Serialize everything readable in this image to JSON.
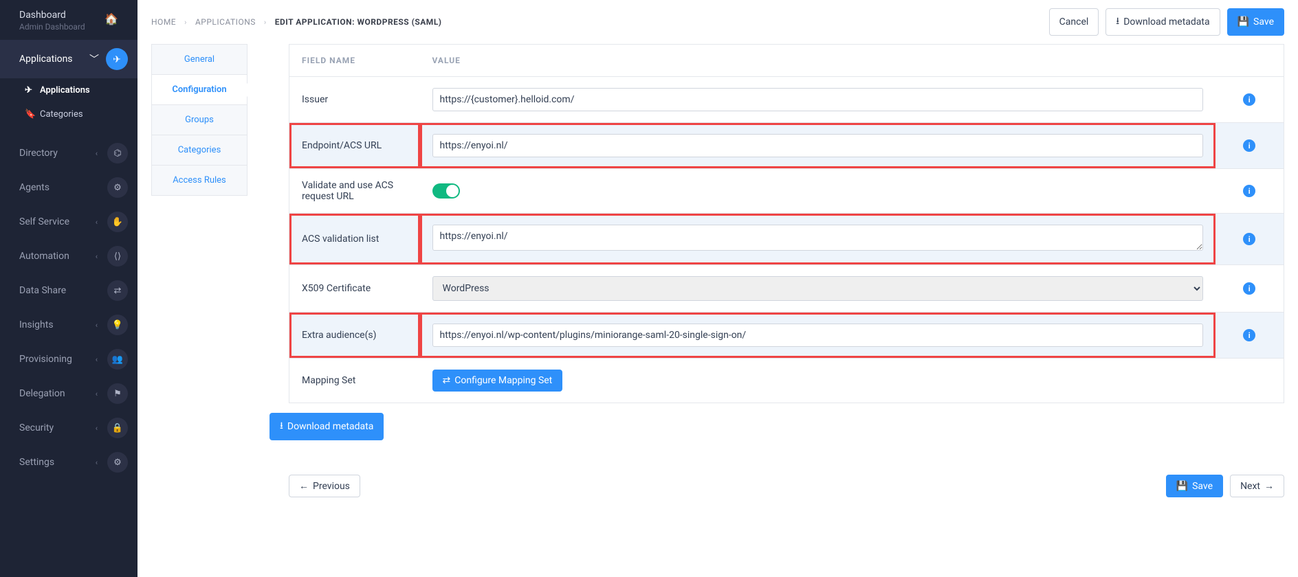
{
  "sidebar": {
    "dashboard": {
      "title": "Dashboard",
      "subtitle": "Admin Dashboard"
    },
    "activeSection": "Applications",
    "sub": {
      "applications": "Applications",
      "categories": "Categories"
    },
    "items": [
      {
        "label": "Directory"
      },
      {
        "label": "Agents"
      },
      {
        "label": "Self Service"
      },
      {
        "label": "Automation"
      },
      {
        "label": "Data Share"
      },
      {
        "label": "Insights"
      },
      {
        "label": "Provisioning"
      },
      {
        "label": "Delegation"
      },
      {
        "label": "Security"
      },
      {
        "label": "Settings"
      }
    ]
  },
  "breadcrumb": {
    "home": "Home",
    "apps": "Applications",
    "current": "Edit Application: WordPress (SAML)"
  },
  "topActions": {
    "cancel": "Cancel",
    "download": "Download metadata",
    "save": "Save"
  },
  "tabs": {
    "general": "General",
    "configuration": "Configuration",
    "groups": "Groups",
    "categories": "Categories",
    "accessRules": "Access Rules"
  },
  "tableHeaders": {
    "field": "Field Name",
    "value": "Value"
  },
  "fields": {
    "issuer": {
      "label": "Issuer",
      "value": "https://{customer}.helloid.com/"
    },
    "endpoint": {
      "label": "Endpoint/ACS URL",
      "value": "https://enyoi.nl/"
    },
    "validateAcs": {
      "label": "Validate and use ACS request URL"
    },
    "acsList": {
      "label": "ACS validation list",
      "value": "https://enyoi.nl/"
    },
    "x509": {
      "label": "X509 Certificate",
      "value": "WordPress"
    },
    "extraAud": {
      "label": "Extra audience(s)",
      "value": "https://enyoi.nl/wp-content/plugins/miniorange-saml-20-single-sign-on/"
    },
    "mapping": {
      "label": "Mapping Set",
      "button": "Configure Mapping Set"
    }
  },
  "buttons": {
    "downloadMeta": "Download metadata",
    "previous": "Previous",
    "save": "Save",
    "next": "Next"
  }
}
